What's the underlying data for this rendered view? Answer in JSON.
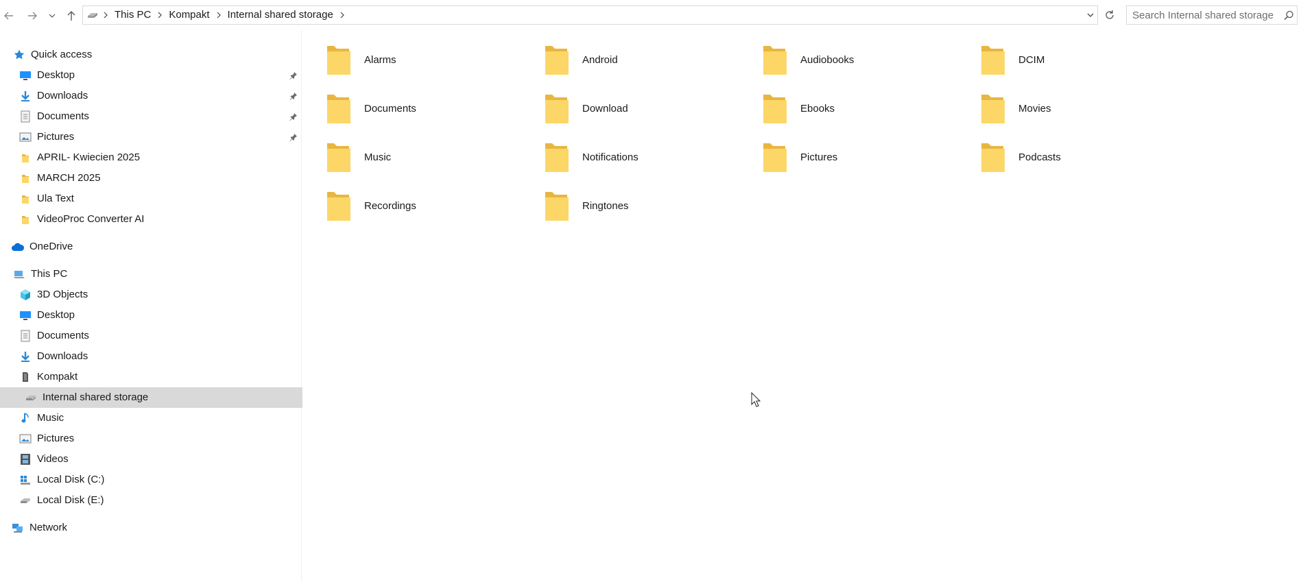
{
  "window": {
    "address": {
      "crumbs": [
        "This PC",
        "Kompakt",
        "Internal shared storage"
      ]
    },
    "search": {
      "placeholder": "Search Internal shared storage"
    }
  },
  "sidebar": {
    "quick_access": {
      "label": "Quick access",
      "items": [
        {
          "label": "Desktop",
          "pinned": true,
          "icon": "desktop-icon"
        },
        {
          "label": "Downloads",
          "pinned": true,
          "icon": "downloads-icon"
        },
        {
          "label": "Documents",
          "pinned": true,
          "icon": "documents-icon"
        },
        {
          "label": "Pictures",
          "pinned": true,
          "icon": "pictures-icon"
        },
        {
          "label": "APRIL- Kwiecien 2025",
          "pinned": false,
          "icon": "folder-icon"
        },
        {
          "label": "MARCH 2025",
          "pinned": false,
          "icon": "folder-icon"
        },
        {
          "label": "Ula Text",
          "pinned": false,
          "icon": "folder-icon"
        },
        {
          "label": "VideoProc Converter AI",
          "pinned": false,
          "icon": "folder-icon"
        }
      ]
    },
    "onedrive": {
      "label": "OneDrive"
    },
    "this_pc": {
      "label": "This PC",
      "items": [
        {
          "label": "3D Objects"
        },
        {
          "label": "Desktop"
        },
        {
          "label": "Documents"
        },
        {
          "label": "Downloads"
        },
        {
          "label": "Kompakt"
        },
        {
          "label": "Internal shared storage",
          "selected": true
        },
        {
          "label": "Music"
        },
        {
          "label": "Pictures"
        },
        {
          "label": "Videos"
        },
        {
          "label": "Local Disk (C:)"
        },
        {
          "label": "Local Disk (E:)"
        }
      ]
    },
    "network": {
      "label": "Network"
    }
  },
  "folders": [
    "Alarms",
    "Android",
    "Audiobooks",
    "DCIM",
    "Documents",
    "Download",
    "Ebooks",
    "Movies",
    "Music",
    "Notifications",
    "Pictures",
    "Podcasts",
    "Recordings",
    "Ringtones"
  ],
  "colors": {
    "folder_back": "#e8b640",
    "folder_front": "#fcd768",
    "selection": "#d9d9d9",
    "accent_blue": "#1e90ff"
  }
}
